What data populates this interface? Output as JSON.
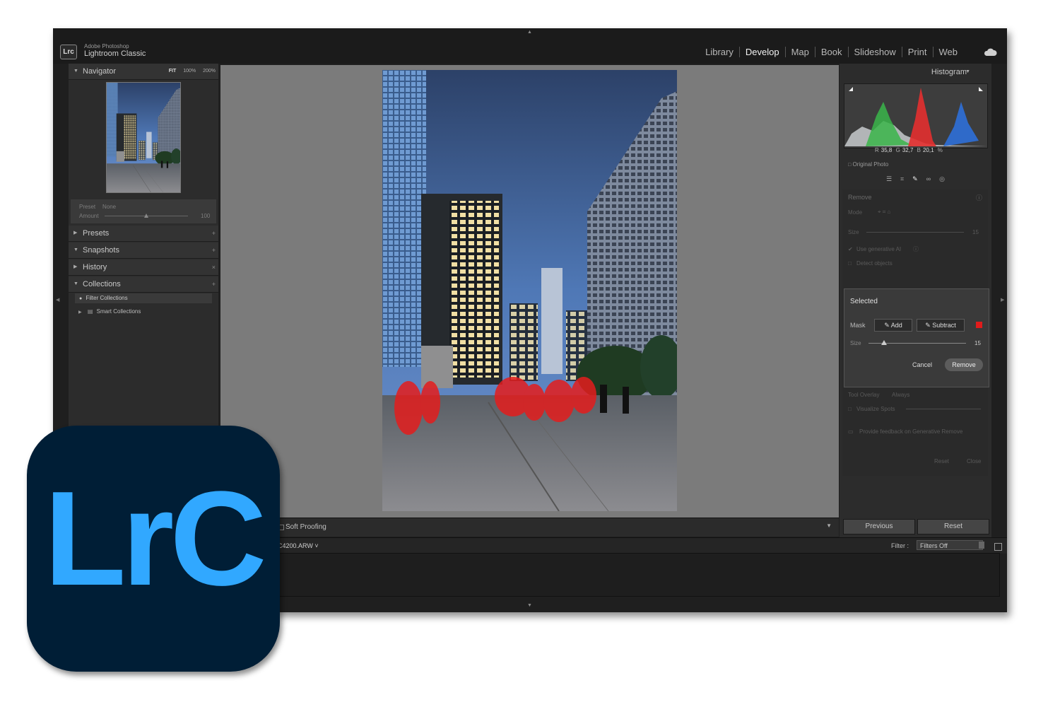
{
  "app": {
    "vendor": "Adobe Photoshop",
    "name": "Lightroom Classic",
    "badge": "Lrc",
    "logo_text": "LrC",
    "accent_color": "#31a8ff",
    "logo_bg": "#001e36"
  },
  "modules": [
    "Library",
    "Develop",
    "Map",
    "Book",
    "Slideshow",
    "Print",
    "Web"
  ],
  "active_module": "Develop",
  "left_panel": {
    "navigator": {
      "title": "Navigator",
      "zoom": [
        "FIT",
        "100%",
        "200%"
      ]
    },
    "preset": {
      "label": "Preset",
      "value": "None",
      "amount_label": "Amount",
      "amount_value": "100"
    },
    "sections": [
      "Presets",
      "Snapshots",
      "History",
      "Collections"
    ],
    "collections": {
      "filter": "Filter Collections",
      "smart": "Smart Collections"
    }
  },
  "toolbar": {
    "soft_proofing": "Soft Proofing"
  },
  "histogram": {
    "title": "Histogram",
    "r_label": "R",
    "r_value": "35,8",
    "g_label": "G",
    "g_value": "32,7",
    "b_label": "B",
    "b_value": "20,1",
    "percent": "%",
    "original_photo": "Original Photo"
  },
  "remove_panel": {
    "title": "Remove",
    "mode_label": "Mode",
    "size_label": "Size",
    "size_value": "15",
    "use_gen_ai": "Use generative AI",
    "detect_objects": "Detect objects",
    "tool_overlay_label": "Tool Overlay",
    "tool_overlay_value": "Always",
    "visualize_spots": "Visualize Spots",
    "feedback": "Provide feedback on Generative Remove",
    "reset": "Reset",
    "close": "Close"
  },
  "selected": {
    "title": "Selected",
    "mask_label": "Mask",
    "add": "Add",
    "subtract": "Subtract",
    "size_label": "Size",
    "size_value": "15",
    "cancel": "Cancel",
    "remove": "Remove",
    "mask_color": "#e01b1b"
  },
  "buttons": {
    "previous": "Previous",
    "reset": "Reset"
  },
  "filmstrip": {
    "filename": "C4200.ARW",
    "filter_label": "Filter :",
    "filter_value": "Filters Off"
  }
}
